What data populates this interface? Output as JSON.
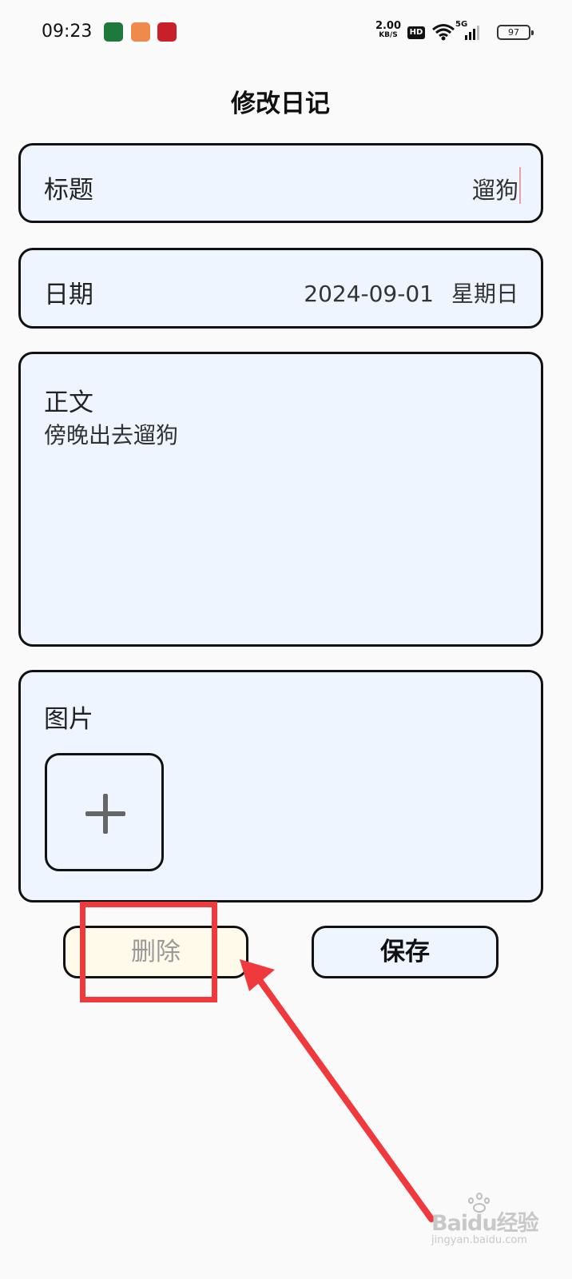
{
  "status_bar": {
    "time": "09:23",
    "net_speed_value": "2.00",
    "net_speed_unit": "KB/S",
    "hd_label": "HD",
    "network_label": "5G",
    "battery": "97",
    "app_icons": [
      "oppo-store-icon",
      "orange-app-icon",
      "red-app-icon"
    ]
  },
  "page": {
    "title": "修改日记"
  },
  "form": {
    "title_label": "标题",
    "title_value": "遛狗",
    "date_label": "日期",
    "date_value": "2024-09-01",
    "weekday_value": "星期日",
    "body_label": "正文",
    "body_value": "傍晚出去遛狗",
    "images_label": "图片"
  },
  "actions": {
    "delete_label": "删除",
    "save_label": "保存"
  },
  "watermark": {
    "text": "Baidu经验",
    "url": "jingyan.baidu.com"
  },
  "colors": {
    "card_bg": "#eef5ff",
    "delete_bg": "#fffaea",
    "annotation_red": "#f0393c",
    "border": "#111111"
  }
}
